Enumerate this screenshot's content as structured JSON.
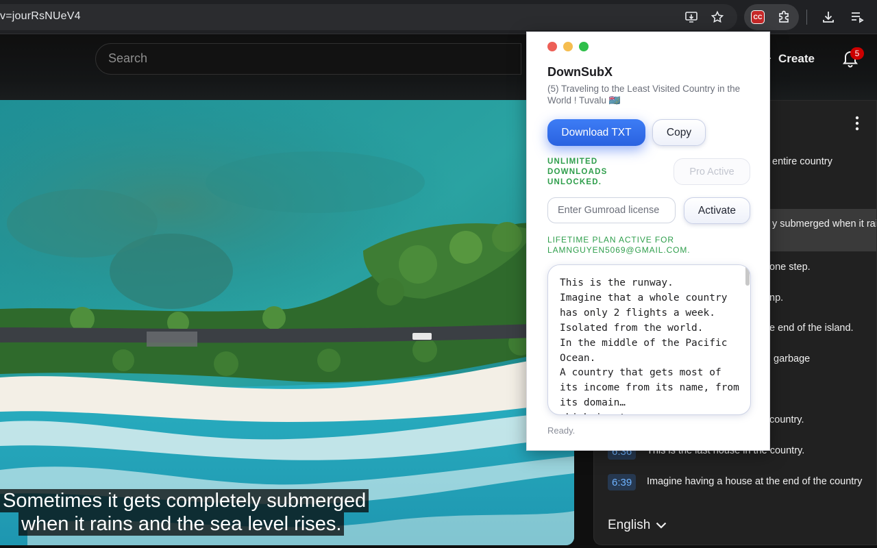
{
  "browser": {
    "url": "v=jourRsNUeV4",
    "icons": [
      "install-app-icon",
      "star-icon",
      "downsubx-extension-icon",
      "extensions-puzzle-icon",
      "download-icon",
      "reading-list-icon"
    ],
    "extension_label": "CC"
  },
  "youtube": {
    "search_placeholder": "Search",
    "create_label": "Create",
    "notification_count": "5",
    "caption_lines": [
      "Sometimes it gets completely submerged",
      "when it rains and the sea level rises."
    ],
    "transcript": {
      "rows": [
        {
          "time": "",
          "text": "entire country"
        },
        {
          "time": "",
          "text": "y submerged when it rains"
        },
        {
          "time": "",
          "text": "one step."
        },
        {
          "time": "",
          "text": "np."
        },
        {
          "time": "",
          "text": "e end of the island."
        },
        {
          "time": "",
          "text": "garbage"
        },
        {
          "time": "",
          "text": "country."
        },
        {
          "time": "6:36",
          "text": "This is the last house in the country."
        },
        {
          "time": "6:39",
          "text": "Imagine having a house at the end of the country"
        }
      ],
      "language": "English"
    }
  },
  "popup": {
    "title": "DownSubX",
    "video_title": "(5) Traveling to the Least Visited Country in the World ! Tuvalu 🇹🇻",
    "download_label": "Download TXT",
    "copy_label": "Copy",
    "unlimited_text": "UNLIMITED DOWNLOADS UNLOCKED.",
    "pro_label": "Pro Active",
    "license_placeholder": "Enter Gumroad license",
    "activate_label": "Activate",
    "lifetime_text": "LIFETIME PLAN ACTIVE FOR LAMNGUYEN5069@GMAIL.COM.",
    "transcript_text": "This is the runway.\nImagine that a whole country has only 2 flights a week.\nIsolated from the world.\nIn the middle of the Pacific Ocean.\nA country that gets most of its income from its name, from its domain…\nwhich is .tv",
    "status": "Ready.",
    "colors": {
      "primary": "#2f6ff0",
      "success": "#2e9e4b",
      "dot_red": "#ed5f56",
      "dot_yellow": "#f5bd4f",
      "dot_green": "#2fbf4a"
    }
  }
}
